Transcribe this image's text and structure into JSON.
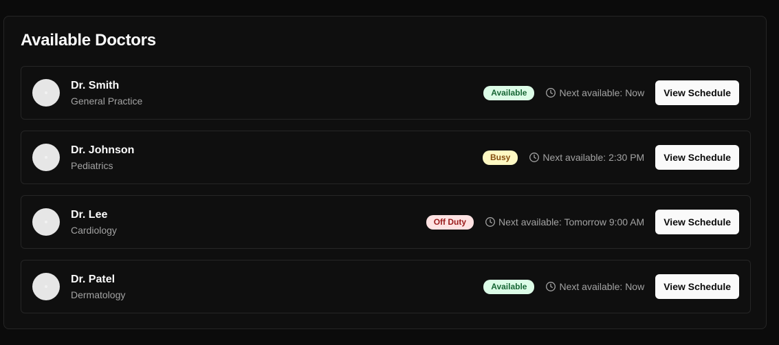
{
  "header": {
    "title": "Available Doctors"
  },
  "doctors": [
    {
      "name": "Dr. Smith",
      "specialty": "General Practice",
      "status": "Available",
      "status_key": "available",
      "next": "Next available: Now",
      "action": "View Schedule"
    },
    {
      "name": "Dr. Johnson",
      "specialty": "Pediatrics",
      "status": "Busy",
      "status_key": "busy",
      "next": "Next available: 2:30 PM",
      "action": "View Schedule"
    },
    {
      "name": "Dr. Lee",
      "specialty": "Cardiology",
      "status": "Off Duty",
      "status_key": "offduty",
      "next": "Next available: Tomorrow 9:00 AM",
      "action": "View Schedule"
    },
    {
      "name": "Dr. Patel",
      "specialty": "Dermatology",
      "status": "Available",
      "status_key": "available",
      "next": "Next available: Now",
      "action": "View Schedule"
    }
  ],
  "colors": {
    "background": "#0b0b0b",
    "card": "#0f0f0f",
    "border": "#262626",
    "available_bg": "#dcfce7",
    "busy_bg": "#fef9c3",
    "offduty_bg": "#fee2e2"
  },
  "icons": {
    "status_time": "clock-icon",
    "avatar": "avatar-placeholder"
  }
}
